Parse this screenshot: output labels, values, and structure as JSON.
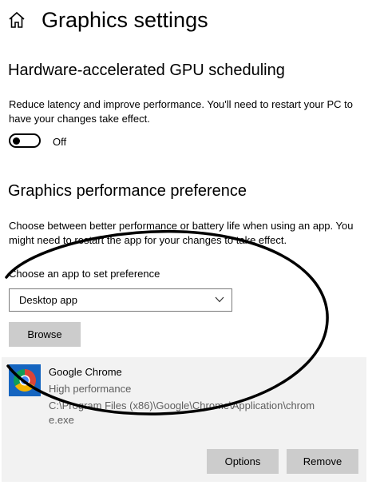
{
  "header": {
    "icon": "home-icon",
    "title": "Graphics settings"
  },
  "gpu_scheduling": {
    "title": "Hardware-accelerated GPU scheduling",
    "description": "Reduce latency and improve performance. You'll need to restart your PC to have your changes take effect.",
    "toggle_state": "Off"
  },
  "performance_preference": {
    "title": "Graphics performance preference",
    "description": "Choose between better performance or battery life when using an app. You might need to restart the app for your changes to take effect.",
    "choose_label": "Choose an app to set preference",
    "dropdown_value": "Desktop app",
    "browse_label": "Browse"
  },
  "app_entry": {
    "icon": "chrome-icon",
    "name": "Google Chrome",
    "performance": "High performance",
    "path": "C:\\Program Files (x86)\\Google\\Chrome\\Application\\chrome.exe",
    "options_label": "Options",
    "remove_label": "Remove"
  },
  "colors": {
    "button_bg": "#cccccc",
    "panel_bg": "#f2f2f2",
    "secondary_text": "#5e5e5e"
  }
}
